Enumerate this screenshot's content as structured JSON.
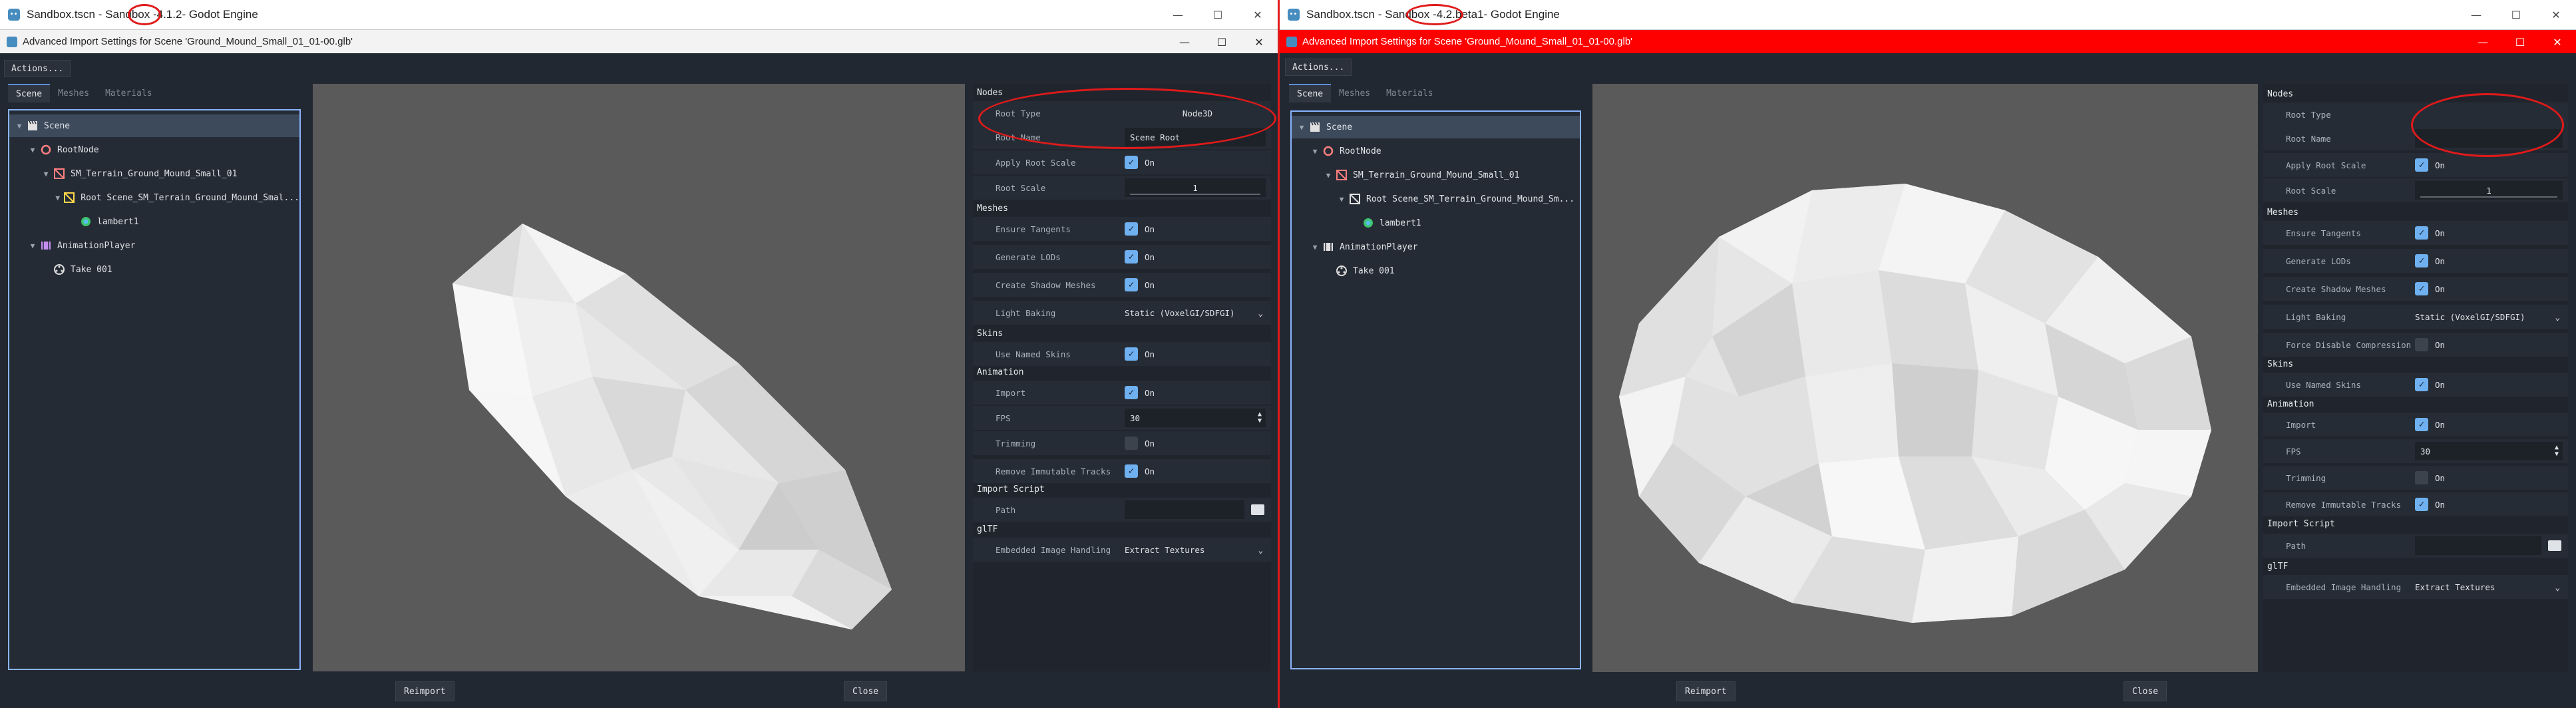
{
  "left": {
    "title_pre": "Sandbox.tscn - Sandbox - ",
    "title_ver": "4.1.2",
    "title_post": " - Godot Engine",
    "dialog_title": "Advanced Import Settings for Scene 'Ground_Mound_Small_01_01-00.glb'",
    "actions_label": "Actions...",
    "tabs": [
      "Scene",
      "Meshes",
      "Materials"
    ],
    "tree": [
      "Scene",
      "RootNode",
      "SM_Terrain_Ground_Mound_Small_01",
      "Root Scene_SM_Terrain_Ground_Mound_Smal...",
      "lambert1",
      "AnimationPlayer",
      "Take 001"
    ],
    "sections": {
      "nodes": "Nodes",
      "meshes": "Meshes",
      "skins": "Skins",
      "animation": "Animation",
      "import_script": "Import Script",
      "gltf": "glTF"
    },
    "props": {
      "root_type": {
        "label": "Root Type",
        "value": "Node3D"
      },
      "root_name": {
        "label": "Root Name",
        "value": "Scene Root"
      },
      "apply_root_scale": {
        "label": "Apply Root Scale",
        "value": "On"
      },
      "root_scale": {
        "label": "Root Scale",
        "value": "1"
      },
      "ensure_tangents": {
        "label": "Ensure Tangents",
        "value": "On"
      },
      "generate_lods": {
        "label": "Generate LODs",
        "value": "On"
      },
      "create_shadow_meshes": {
        "label": "Create Shadow Meshes",
        "value": "On"
      },
      "light_baking": {
        "label": "Light Baking",
        "value": "Static (VoxelGI/SDFGI)"
      },
      "use_named_skins": {
        "label": "Use Named Skins",
        "value": "On"
      },
      "import": {
        "label": "Import",
        "value": "On"
      },
      "fps": {
        "label": "FPS",
        "value": "30"
      },
      "trimming": {
        "label": "Trimming",
        "value": "On"
      },
      "remove_immutable_tracks": {
        "label": "Remove Immutable Tracks",
        "value": "On"
      },
      "path": {
        "label": "Path",
        "value": ""
      },
      "embedded_image_handling": {
        "label": "Embedded Image Handling",
        "value": "Extract Textures"
      }
    },
    "reimport": "Reimport",
    "close": "Close"
  },
  "right": {
    "title_pre": "Sandbox.tscn - Sandbox - ",
    "title_ver": "4.2.beta1",
    "title_post": " - Godot Engine",
    "dialog_title": "Advanced Import Settings for Scene 'Ground_Mound_Small_01_01-00.glb'",
    "actions_label": "Actions...",
    "tabs": [
      "Scene",
      "Meshes",
      "Materials"
    ],
    "tree": [
      "Scene",
      "RootNode",
      "SM_Terrain_Ground_Mound_Small_01",
      "Root Scene_SM_Terrain_Ground_Mound_Sm...",
      "lambert1",
      "AnimationPlayer",
      "Take 001"
    ],
    "sections": {
      "nodes": "Nodes",
      "meshes": "Meshes",
      "skins": "Skins",
      "animation": "Animation",
      "import_script": "Import Script",
      "gltf": "glTF"
    },
    "props": {
      "root_type": {
        "label": "Root Type",
        "value": ""
      },
      "root_name": {
        "label": "Root Name",
        "value": ""
      },
      "apply_root_scale": {
        "label": "Apply Root Scale",
        "value": "On"
      },
      "root_scale": {
        "label": "Root Scale",
        "value": "1"
      },
      "ensure_tangents": {
        "label": "Ensure Tangents",
        "value": "On"
      },
      "generate_lods": {
        "label": "Generate LODs",
        "value": "On"
      },
      "create_shadow_meshes": {
        "label": "Create Shadow Meshes",
        "value": "On"
      },
      "light_baking": {
        "label": "Light Baking",
        "value": "Static (VoxelGI/SDFGI)"
      },
      "force_disable_compression": {
        "label": "Force Disable Compression",
        "value": "On"
      },
      "use_named_skins": {
        "label": "Use Named Skins",
        "value": "On"
      },
      "import": {
        "label": "Import",
        "value": "On"
      },
      "fps": {
        "label": "FPS",
        "value": "30"
      },
      "trimming": {
        "label": "Trimming",
        "value": "On"
      },
      "remove_immutable_tracks": {
        "label": "Remove Immutable Tracks",
        "value": "On"
      },
      "path": {
        "label": "Path",
        "value": ""
      },
      "embedded_image_handling": {
        "label": "Embedded Image Handling",
        "value": "Extract Textures"
      }
    },
    "reimport": "Reimport",
    "close": "Close"
  },
  "window_controls": {
    "minimize": "—",
    "maximize": "☐",
    "close": "✕"
  },
  "colors": {
    "accent": "#6fb0f0",
    "annotation": "#e01a1a",
    "active_dialog": "#ff0000"
  }
}
